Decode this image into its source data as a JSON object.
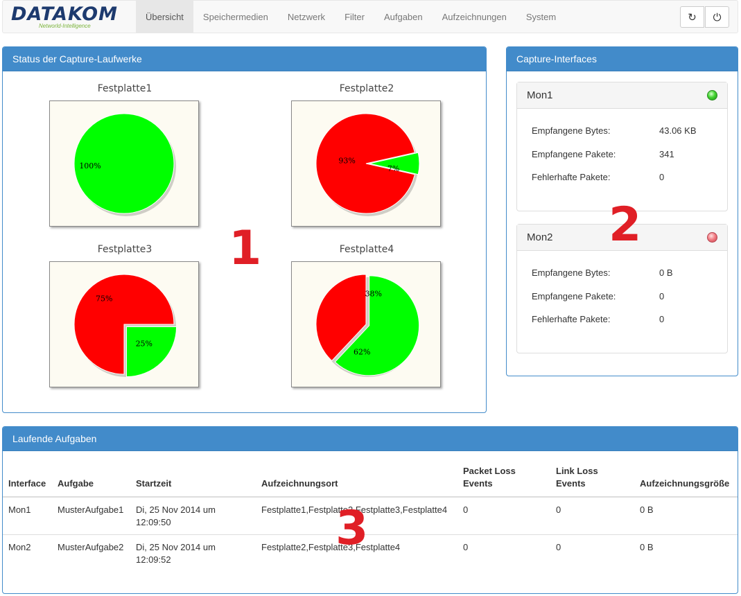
{
  "logo": {
    "text": "DATAKOM",
    "subtitle": "Networld-Intelligence"
  },
  "nav": {
    "items": [
      "Übersicht",
      "Speichermedien",
      "Netzwerk",
      "Filter",
      "Aufgaben",
      "Aufzeichnungen",
      "System"
    ],
    "active_index": 0,
    "buttons": [
      {
        "name": "refresh-icon",
        "glyph": "↻"
      },
      {
        "name": "power-icon",
        "glyph": "⏻"
      }
    ]
  },
  "drives_panel": {
    "title": "Status der Capture-Laufwerke",
    "annotation": "1",
    "colors": {
      "used": "#ff0000",
      "free": "#00ff00"
    },
    "chart_data": [
      {
        "type": "pie",
        "title": "Festplatte1",
        "slices": [
          {
            "color": "free",
            "value": 100,
            "label": "100%"
          }
        ]
      },
      {
        "type": "pie",
        "title": "Festplatte2",
        "slices": [
          {
            "color": "used",
            "value": 93,
            "label": "93%"
          },
          {
            "color": "free",
            "value": 7,
            "label": "7%"
          }
        ]
      },
      {
        "type": "pie",
        "title": "Festplatte3",
        "slices": [
          {
            "color": "used",
            "value": 75,
            "label": "75%"
          },
          {
            "color": "free",
            "value": 25,
            "label": "25%"
          }
        ]
      },
      {
        "type": "pie",
        "title": "Festplatte4",
        "slices": [
          {
            "color": "used",
            "value": 38,
            "label": "38%"
          },
          {
            "color": "free",
            "value": 62,
            "label": "62%"
          }
        ]
      }
    ]
  },
  "interfaces_panel": {
    "title": "Capture-Interfaces",
    "annotation": "2",
    "interfaces": [
      {
        "name": "Mon1",
        "status": "green",
        "stats": [
          {
            "label": "Empfangene Bytes:",
            "value": "43.06 KB"
          },
          {
            "label": "Empfangene Pakete:",
            "value": "341"
          },
          {
            "label": "Fehlerhafte Pakete:",
            "value": "0"
          }
        ]
      },
      {
        "name": "Mon2",
        "status": "red",
        "stats": [
          {
            "label": "Empfangene Bytes:",
            "value": "0 B"
          },
          {
            "label": "Empfangene Pakete:",
            "value": "0"
          },
          {
            "label": "Fehlerhafte Pakete:",
            "value": "0"
          }
        ]
      }
    ]
  },
  "tasks_panel": {
    "title": "Laufende Aufgaben",
    "annotation": "3",
    "columns": [
      "Interface",
      "Aufgabe",
      "Startzeit",
      "Aufzeichnungsort",
      "Packet Loss Events",
      "Link Loss Events",
      "Aufzeichnungsgröße"
    ],
    "rows": [
      [
        "Mon1",
        "MusterAufgabe1",
        "Di, 25 Nov 2014 um 12:09:50",
        "Festplatte1,Festplatte2,Festplatte3,Festplatte4",
        "0",
        "0",
        "0 B"
      ],
      [
        "Mon2",
        "MusterAufgabe2",
        "Di, 25 Nov 2014 um 12:09:52",
        "Festplatte2,Festplatte3,Festplatte4",
        "0",
        "0",
        "0 B"
      ]
    ]
  }
}
